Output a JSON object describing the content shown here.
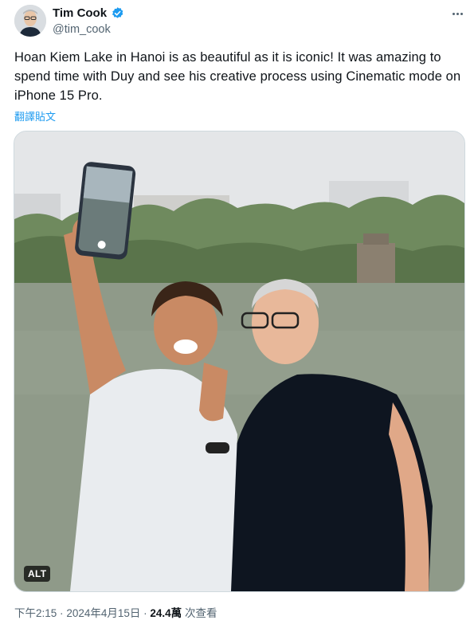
{
  "author": {
    "display_name": "Tim Cook",
    "handle": "@tim_cook",
    "avatar_icon": "profile-photo",
    "verified_icon": "verified-badge-icon",
    "verified_color": "#1d9bf0"
  },
  "more_icon": "more-options-icon",
  "tweet": {
    "text": "Hoan Kiem Lake in Hanoi is as beautiful as it is iconic! It was amazing to spend time with Duy and see his creative process using Cinematic mode on iPhone 15 Pro.",
    "translate_label": "翻譯貼文"
  },
  "media": {
    "alt_label": "ALT"
  },
  "meta": {
    "time": "下午2:15",
    "separator": "·",
    "date": "2024年4月15日",
    "views_count": "24.4萬",
    "views_label": "次查看"
  },
  "colors": {
    "text_primary": "#0f1419",
    "text_secondary": "#536471",
    "link": "#1d9bf0",
    "border": "#cfd9de"
  }
}
